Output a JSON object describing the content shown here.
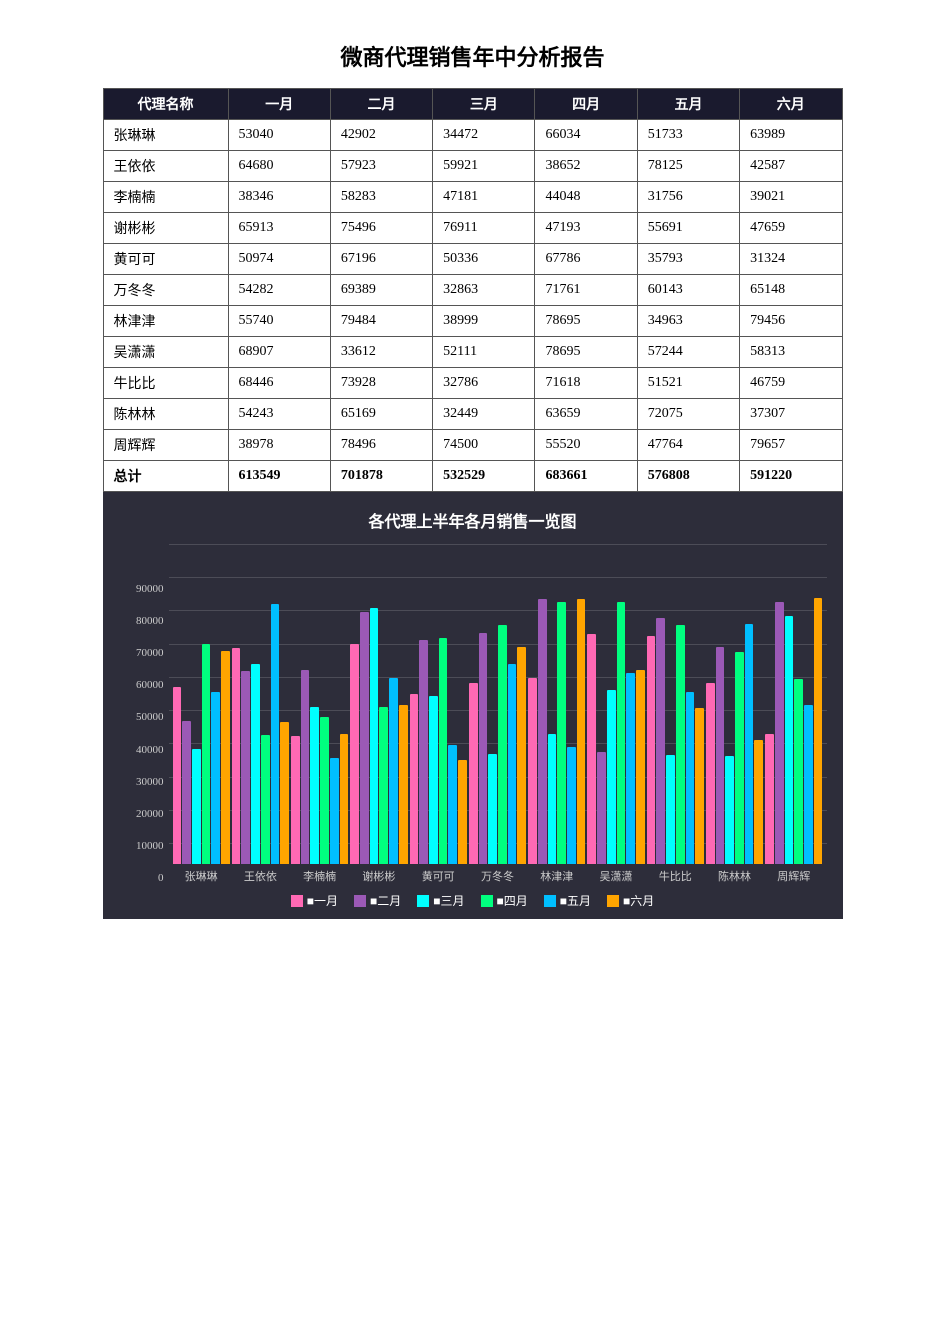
{
  "title": "微商代理销售年中分析报告",
  "table": {
    "headers": [
      "代理名称",
      "一月",
      "二月",
      "三月",
      "四月",
      "五月",
      "六月"
    ],
    "rows": [
      {
        "name": "张琳琳",
        "jan": 53040,
        "feb": 42902,
        "mar": 34472,
        "apr": 66034,
        "may": 51733,
        "jun": 63989
      },
      {
        "name": "王依依",
        "jan": 64680,
        "feb": 57923,
        "mar": 59921,
        "apr": 38652,
        "may": 78125,
        "jun": 42587
      },
      {
        "name": "李楠楠",
        "jan": 38346,
        "feb": 58283,
        "mar": 47181,
        "apr": 44048,
        "may": 31756,
        "jun": 39021
      },
      {
        "name": "谢彬彬",
        "jan": 65913,
        "feb": 75496,
        "mar": 76911,
        "apr": 47193,
        "may": 55691,
        "jun": 47659
      },
      {
        "name": "黄可可",
        "jan": 50974,
        "feb": 67196,
        "mar": 50336,
        "apr": 67786,
        "may": 35793,
        "jun": 31324
      },
      {
        "name": "万冬冬",
        "jan": 54282,
        "feb": 69389,
        "mar": 32863,
        "apr": 71761,
        "may": 60143,
        "jun": 65148
      },
      {
        "name": "林津津",
        "jan": 55740,
        "feb": 79484,
        "mar": 38999,
        "apr": 78695,
        "may": 34963,
        "jun": 79456
      },
      {
        "name": "吴潇潇",
        "jan": 68907,
        "feb": 33612,
        "mar": 52111,
        "apr": 78695,
        "may": 57244,
        "jun": 58313
      },
      {
        "name": "牛比比",
        "jan": 68446,
        "feb": 73928,
        "mar": 32786,
        "apr": 71618,
        "may": 51521,
        "jun": 46759
      },
      {
        "name": "陈林林",
        "jan": 54243,
        "feb": 65169,
        "mar": 32449,
        "apr": 63659,
        "may": 72075,
        "jun": 37307
      },
      {
        "name": "周辉辉",
        "jan": 38978,
        "feb": 78496,
        "mar": 74500,
        "apr": 55520,
        "may": 47764,
        "jun": 79657
      }
    ],
    "totals": {
      "name": "总计",
      "jan": 613549,
      "feb": 701878,
      "mar": 532529,
      "apr": 683661,
      "may": 576808,
      "jun": 591220
    }
  },
  "chart": {
    "title": "各代理上半年各月销售一览图",
    "yLabels": [
      "0",
      "10000",
      "20000",
      "30000",
      "40000",
      "50000",
      "60000",
      "70000",
      "80000",
      "90000"
    ],
    "maxValue": 90000,
    "colors": {
      "jan": "#ff69b4",
      "feb": "#9b59b6",
      "mar": "#00ffff",
      "apr": "#00ff7f",
      "may": "#00bfff",
      "jun": "#ffa500"
    },
    "legend": [
      {
        "label": "一月",
        "color": "#ff69b4"
      },
      {
        "label": "二月",
        "color": "#9b59b6"
      },
      {
        "label": "三月",
        "color": "#00ffff"
      },
      {
        "label": "四月",
        "color": "#00ff7f"
      },
      {
        "label": "五月",
        "color": "#00bfff"
      },
      {
        "label": "六月",
        "color": "#ffa500"
      }
    ]
  }
}
